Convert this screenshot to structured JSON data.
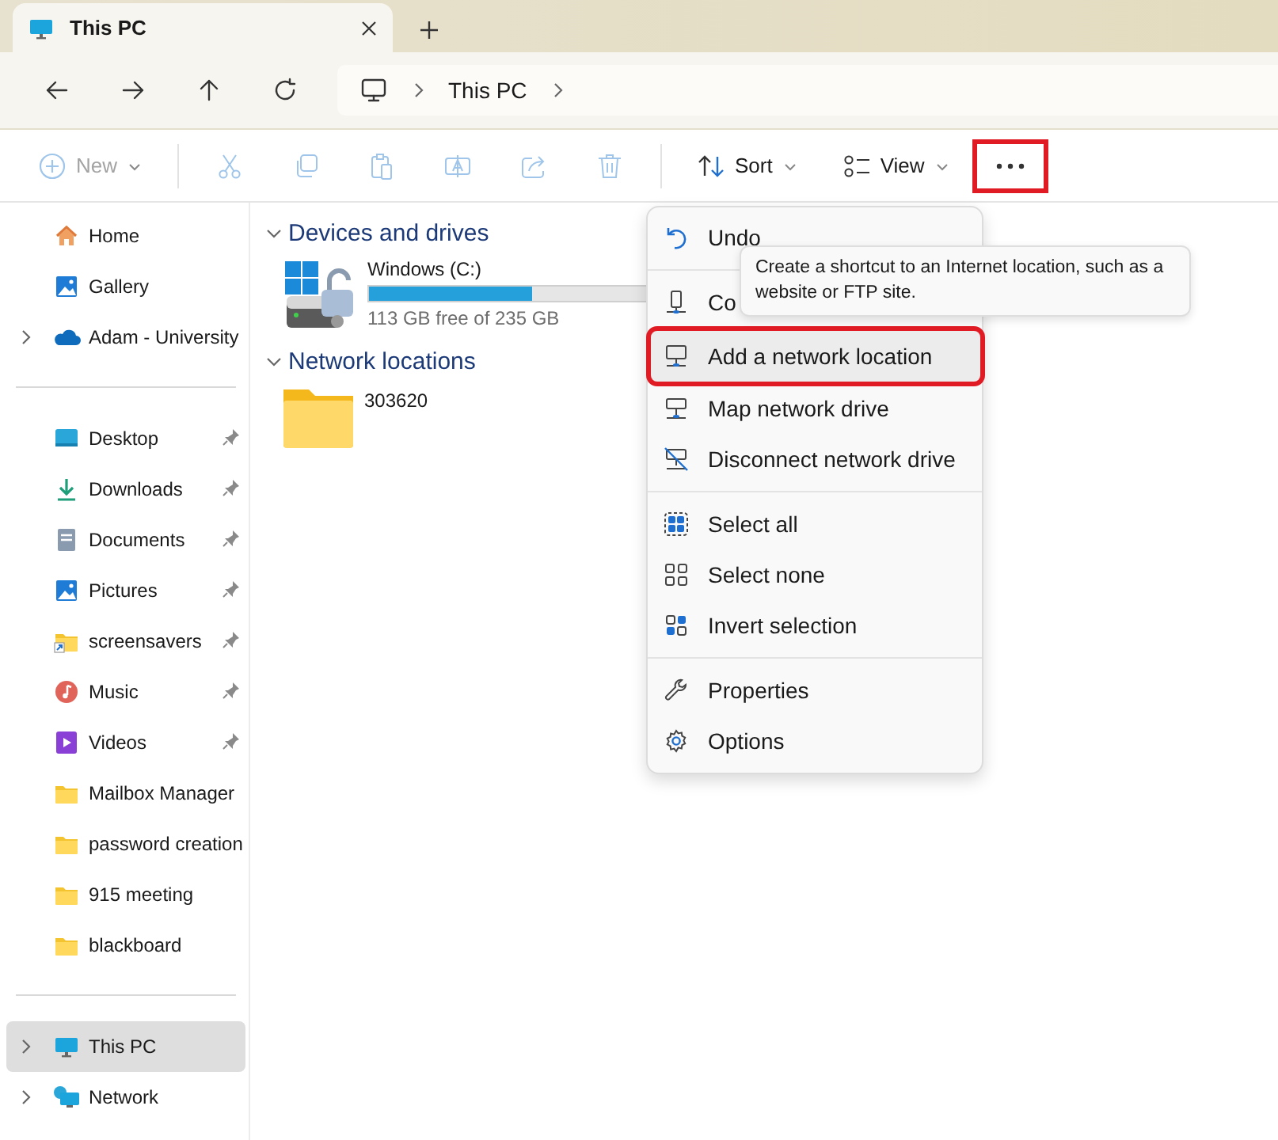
{
  "tab": {
    "title": "This PC",
    "selected": true
  },
  "address": {
    "crumbs": [
      "This PC"
    ]
  },
  "toolbar": {
    "items": [
      {
        "kind": "new",
        "label": "New",
        "disabled": true,
        "highlighted": false
      },
      {
        "kind": "cut",
        "disabled": true,
        "highlighted": false
      },
      {
        "kind": "copy",
        "disabled": true,
        "highlighted": false
      },
      {
        "kind": "paste",
        "disabled": true,
        "highlighted": false
      },
      {
        "kind": "rename",
        "disabled": true,
        "highlighted": false
      },
      {
        "kind": "share",
        "disabled": true,
        "highlighted": false
      },
      {
        "kind": "delete",
        "disabled": true,
        "highlighted": false
      },
      {
        "kind": "sort",
        "label": "Sort",
        "disabled": false,
        "highlighted": false
      },
      {
        "kind": "view",
        "label": "View",
        "disabled": false,
        "highlighted": false
      },
      {
        "kind": "more",
        "disabled": false,
        "highlighted": true
      }
    ]
  },
  "sidebar": {
    "sections": [
      {
        "items": [
          {
            "kind": "home",
            "label": "Home",
            "pinned": false,
            "expandable": false,
            "selected": false
          },
          {
            "kind": "gallery",
            "label": "Gallery",
            "pinned": false,
            "expandable": false,
            "selected": false
          },
          {
            "kind": "cloud",
            "label": "Adam - University",
            "pinned": false,
            "expandable": true,
            "selected": false
          }
        ]
      },
      {
        "items": [
          {
            "kind": "desktop",
            "label": "Desktop",
            "pinned": true,
            "expandable": false,
            "selected": false
          },
          {
            "kind": "downloads",
            "label": "Downloads",
            "pinned": true,
            "expandable": false,
            "selected": false
          },
          {
            "kind": "documents",
            "label": "Documents",
            "pinned": true,
            "expandable": false,
            "selected": false
          },
          {
            "kind": "pictures",
            "label": "Pictures",
            "pinned": true,
            "expandable": false,
            "selected": false
          },
          {
            "kind": "shortcut",
            "label": "screensavers",
            "pinned": true,
            "expandable": false,
            "selected": false
          },
          {
            "kind": "music",
            "label": "Music",
            "pinned": true,
            "expandable": false,
            "selected": false
          },
          {
            "kind": "videos",
            "label": "Videos",
            "pinned": true,
            "expandable": false,
            "selected": false
          },
          {
            "kind": "folder",
            "label": "Mailbox Manager",
            "pinned": false,
            "expandable": false,
            "selected": false
          },
          {
            "kind": "folder",
            "label": "password creation",
            "pinned": false,
            "expandable": false,
            "selected": false
          },
          {
            "kind": "folder",
            "label": "915 meeting",
            "pinned": false,
            "expandable": false,
            "selected": false
          },
          {
            "kind": "folder",
            "label": "blackboard",
            "pinned": false,
            "expandable": false,
            "selected": false
          }
        ]
      },
      {
        "items": [
          {
            "kind": "pc",
            "label": "This PC",
            "pinned": false,
            "expandable": true,
            "selected": true
          },
          {
            "kind": "network",
            "label": "Network",
            "pinned": false,
            "expandable": true,
            "selected": false
          }
        ]
      }
    ]
  },
  "content": {
    "groups": [
      {
        "title": "Devices and drives",
        "expanded": true,
        "items": [
          {
            "kind": "drive",
            "name": "Windows (C:)",
            "level": 0.52,
            "caption": "113 GB free of 235 GB"
          }
        ]
      },
      {
        "title": "Network locations",
        "expanded": true,
        "items": [
          {
            "kind": "folder",
            "name": "303620"
          }
        ]
      }
    ]
  },
  "menu": {
    "sections": [
      {
        "items": [
          {
            "kind": "undo",
            "label": "Undo",
            "highlighted": false
          }
        ]
      },
      {
        "items": [
          {
            "kind": "connect",
            "label": "Co",
            "highlighted": false
          },
          {
            "kind": "add-location",
            "label": "Add a network location",
            "highlighted": true
          },
          {
            "kind": "map-drive",
            "label": "Map network drive",
            "highlighted": false
          },
          {
            "kind": "disconnect",
            "label": "Disconnect network drive",
            "highlighted": false
          }
        ]
      },
      {
        "items": [
          {
            "kind": "select-all",
            "label": "Select all",
            "highlighted": false
          },
          {
            "kind": "select-none",
            "label": "Select none",
            "highlighted": false
          },
          {
            "kind": "invert",
            "label": "Invert selection",
            "highlighted": false
          }
        ]
      },
      {
        "items": [
          {
            "kind": "properties",
            "label": "Properties",
            "highlighted": false
          },
          {
            "kind": "options",
            "label": "Options",
            "highlighted": false
          }
        ]
      }
    ]
  },
  "tooltip": {
    "text": "Create a shortcut to an Internet location, such as a website or FTP site."
  }
}
